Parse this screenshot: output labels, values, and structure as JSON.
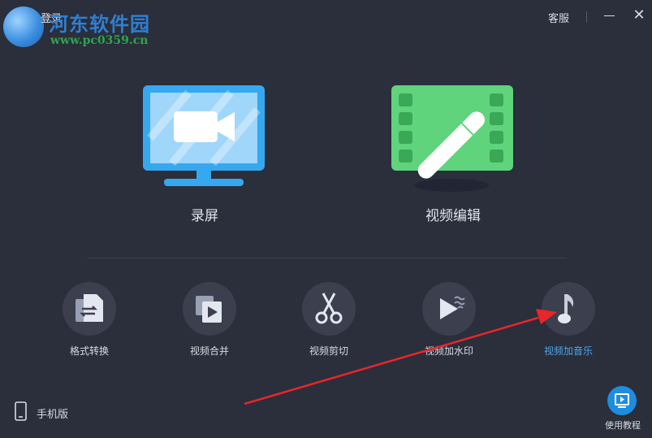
{
  "watermark": {
    "site_name": "河东软件园",
    "url": "www.pc0359.cn"
  },
  "titlebar": {
    "login_label": "登录",
    "service_label": "客服",
    "minimize_symbol": "—",
    "close_symbol": "✕"
  },
  "main_tiles": [
    {
      "label": "录屏",
      "icon": "monitor-camera-icon",
      "color": "#35a8f0"
    },
    {
      "label": "视频编辑",
      "icon": "film-pen-icon",
      "color": "#5fd47c"
    }
  ],
  "tools": [
    {
      "label": "格式转换",
      "icon": "format-convert-icon"
    },
    {
      "label": "视频合并",
      "icon": "video-merge-icon"
    },
    {
      "label": "视频剪切",
      "icon": "scissors-icon"
    },
    {
      "label": "视频加水印",
      "icon": "watermark-icon"
    },
    {
      "label": "视频加音乐",
      "icon": "music-note-icon",
      "active": true
    }
  ],
  "footer": {
    "mobile_label": "手机版",
    "tutorial_label": "使用教程"
  },
  "colors": {
    "background": "#2b2e3b",
    "accent": "#1e8de0",
    "annotation_arrow": "#e8262a"
  }
}
